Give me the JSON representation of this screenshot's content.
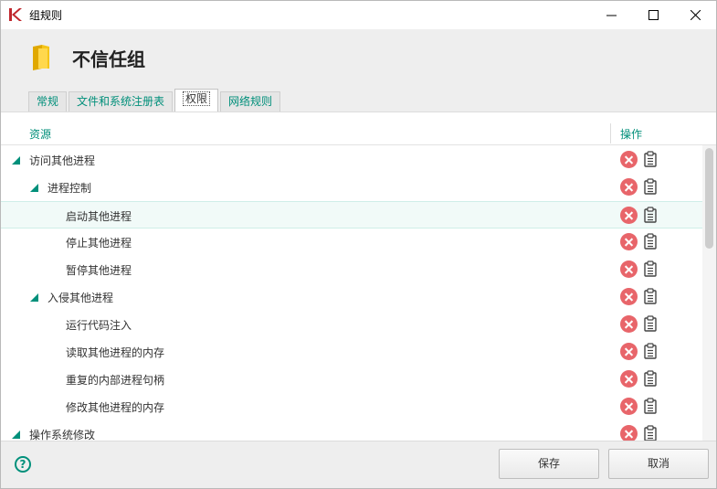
{
  "window": {
    "title": "组规则"
  },
  "header": {
    "group_name": "不信任组"
  },
  "tabs": [
    {
      "label": "常规",
      "active": false
    },
    {
      "label": "文件和系统注册表",
      "active": false
    },
    {
      "label": "权限",
      "active": true
    },
    {
      "label": "网络规则",
      "active": false
    }
  ],
  "table": {
    "col_resource": "资源",
    "col_action": "操作",
    "rows": [
      {
        "label": "访问其他进程",
        "level": 0,
        "expandable": true
      },
      {
        "label": "进程控制",
        "level": 1,
        "expandable": true
      },
      {
        "label": "启动其他进程",
        "level": 2,
        "expandable": false,
        "selected": true
      },
      {
        "label": "停止其他进程",
        "level": 2,
        "expandable": false
      },
      {
        "label": "暂停其他进程",
        "level": 2,
        "expandable": false
      },
      {
        "label": "入侵其他进程",
        "level": 1,
        "expandable": true
      },
      {
        "label": "运行代码注入",
        "level": 2,
        "expandable": false
      },
      {
        "label": "读取其他进程的内存",
        "level": 2,
        "expandable": false
      },
      {
        "label": "重复的内部进程句柄",
        "level": 2,
        "expandable": false
      },
      {
        "label": "修改其他进程的内存",
        "level": 2,
        "expandable": false
      },
      {
        "label": "操作系统修改",
        "level": 0,
        "expandable": true
      }
    ]
  },
  "footer": {
    "save_label": "保存",
    "cancel_label": "取消"
  },
  "colors": {
    "accent": "#00907b",
    "deny": "#e8656a"
  }
}
